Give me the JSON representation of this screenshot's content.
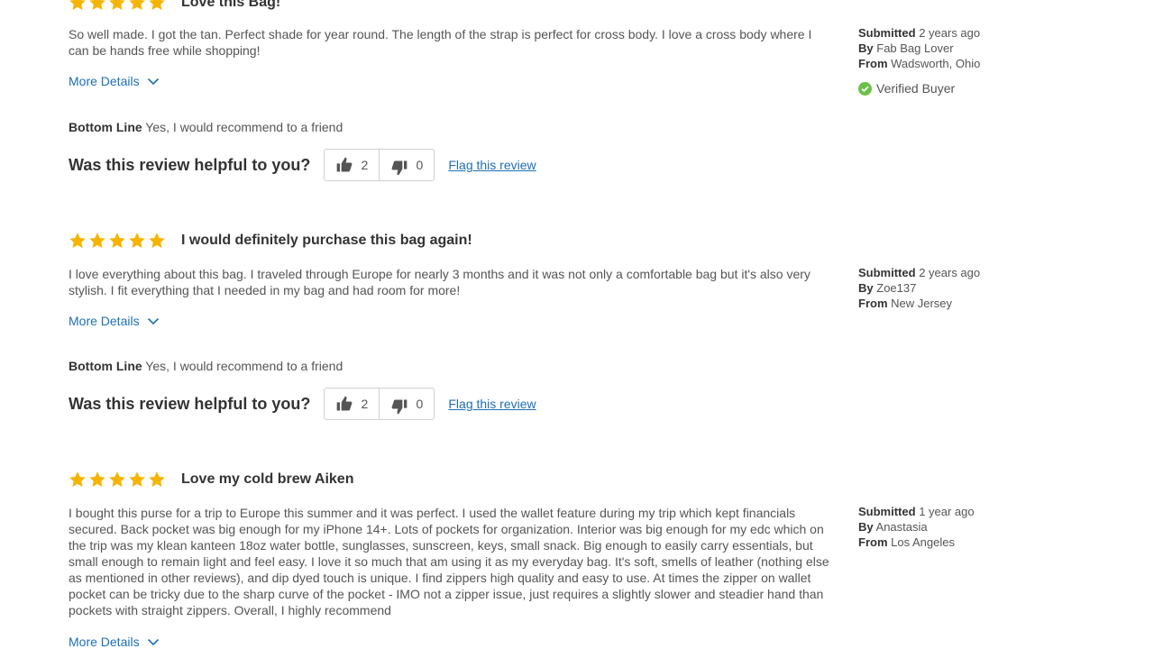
{
  "colors": {
    "star": "#f5b400",
    "link": "#1f6fb2",
    "verified": "#6cc04a"
  },
  "labels": {
    "more_details": "More Details",
    "bottom_line": "Bottom Line",
    "helpful_question": "Was this review helpful to you?",
    "flag": "Flag this review",
    "submitted": "Submitted",
    "by": "By",
    "from": "From",
    "verified_buyer": "Verified Buyer"
  },
  "reviews": [
    {
      "rating": 5,
      "title": "Love this Bag!",
      "body": "So well made. I got the tan. Perfect shade for year round. The length of the strap is perfect for cross body. I love a cross body where I can be hands free while shopping!",
      "bottom_line": "Yes, I would recommend to a friend",
      "helpful_yes": "2",
      "helpful_no": "0",
      "submitted": "2 years ago",
      "author": "Fab Bag Lover",
      "location": "Wadsworth, Ohio",
      "verified": true
    },
    {
      "rating": 5,
      "title": "I would definitely purchase this bag again!",
      "body": "I love everything about this bag. I traveled through Europe for nearly 3 months and it was not only a comfortable bag but it's also very stylish. I fit everything that I needed in my bag and had room for more!",
      "bottom_line": "Yes, I would recommend to a friend",
      "helpful_yes": "2",
      "helpful_no": "0",
      "submitted": "2 years ago",
      "author": "Zoe137",
      "location": "New Jersey",
      "verified": false
    },
    {
      "rating": 5,
      "title": "Love my cold brew Aiken",
      "body": "I bought this purse for a trip to Europe this summer and it was perfect. I used the wallet feature during my trip which kept financials secured. Back pocket was big enough for my iPhone 14+. Lots of pockets for organization. Interior was big enough for my edc which on the trip was my klean kanteen 18oz water bottle, sunglasses, sunscreen, keys, small snack. Big enough to easily carry essentials, but small enough to remain light and feel easy. I love it so much that am using it as my everyday bag. It's soft, smells of leather (nothing else as mentioned in other reviews), and dip dyed touch is unique. I find zippers high quality and easy to use. At times the zipper on wallet pocket can be tricky due to the sharp curve of the pocket - IMO not a zipper issue, just requires a slightly slower and steadier hand than pockets with straight zippers. Overall, I highly recommend",
      "submitted": "1 year ago",
      "author": "Anastasia",
      "location": "Los Angeles",
      "verified": false
    }
  ]
}
